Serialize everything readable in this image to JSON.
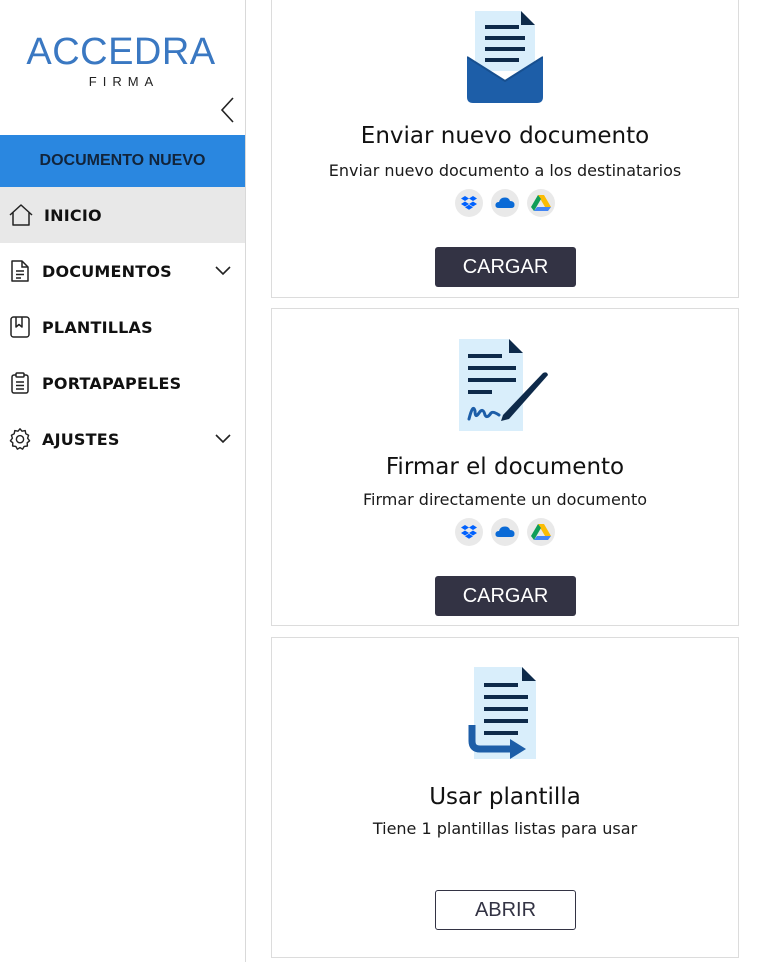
{
  "sidebar": {
    "logo": {
      "main": "ACCEDRA",
      "sub": "FIRMA"
    },
    "collapse_icon": "chevron-left-icon",
    "new_document_label": "DOCUMENTO NUEVO",
    "items": [
      {
        "label": "INICIO",
        "icon": "home-icon",
        "active": true
      },
      {
        "label": "DOCUMENTOS",
        "icon": "document-icon",
        "expandable": true
      },
      {
        "label": "PLANTILLAS",
        "icon": "bookmark-icon"
      },
      {
        "label": "PORTAPAPELES",
        "icon": "clipboard-icon"
      },
      {
        "label": "AJUSTES",
        "icon": "gear-icon",
        "expandable": true
      }
    ]
  },
  "cards": [
    {
      "icon": "envelope-document-icon",
      "title": "Enviar nuevo documento",
      "description": "Enviar nuevo documento a los destinatarios",
      "sources": [
        "dropbox-icon",
        "onedrive-icon",
        "google-drive-icon"
      ],
      "button_label": "CARGAR"
    },
    {
      "icon": "sign-document-icon",
      "title": "Firmar el documento",
      "description": "Firmar directamente un documento",
      "sources": [
        "dropbox-icon",
        "onedrive-icon",
        "google-drive-icon"
      ],
      "button_label": "CARGAR"
    },
    {
      "icon": "template-document-icon",
      "title": "Usar plantilla",
      "description": "Tiene 1 plantillas listas para usar",
      "button_label": "ABRIR"
    }
  ],
  "colors": {
    "primary_blue": "#2a87e0",
    "logo_blue": "#3a78c2",
    "dark_button": "#333344",
    "icon_dark_blue": "#1d5ea8",
    "icon_light_blue": "#d9eefb",
    "active_nav_bg": "#e8e8e8"
  }
}
